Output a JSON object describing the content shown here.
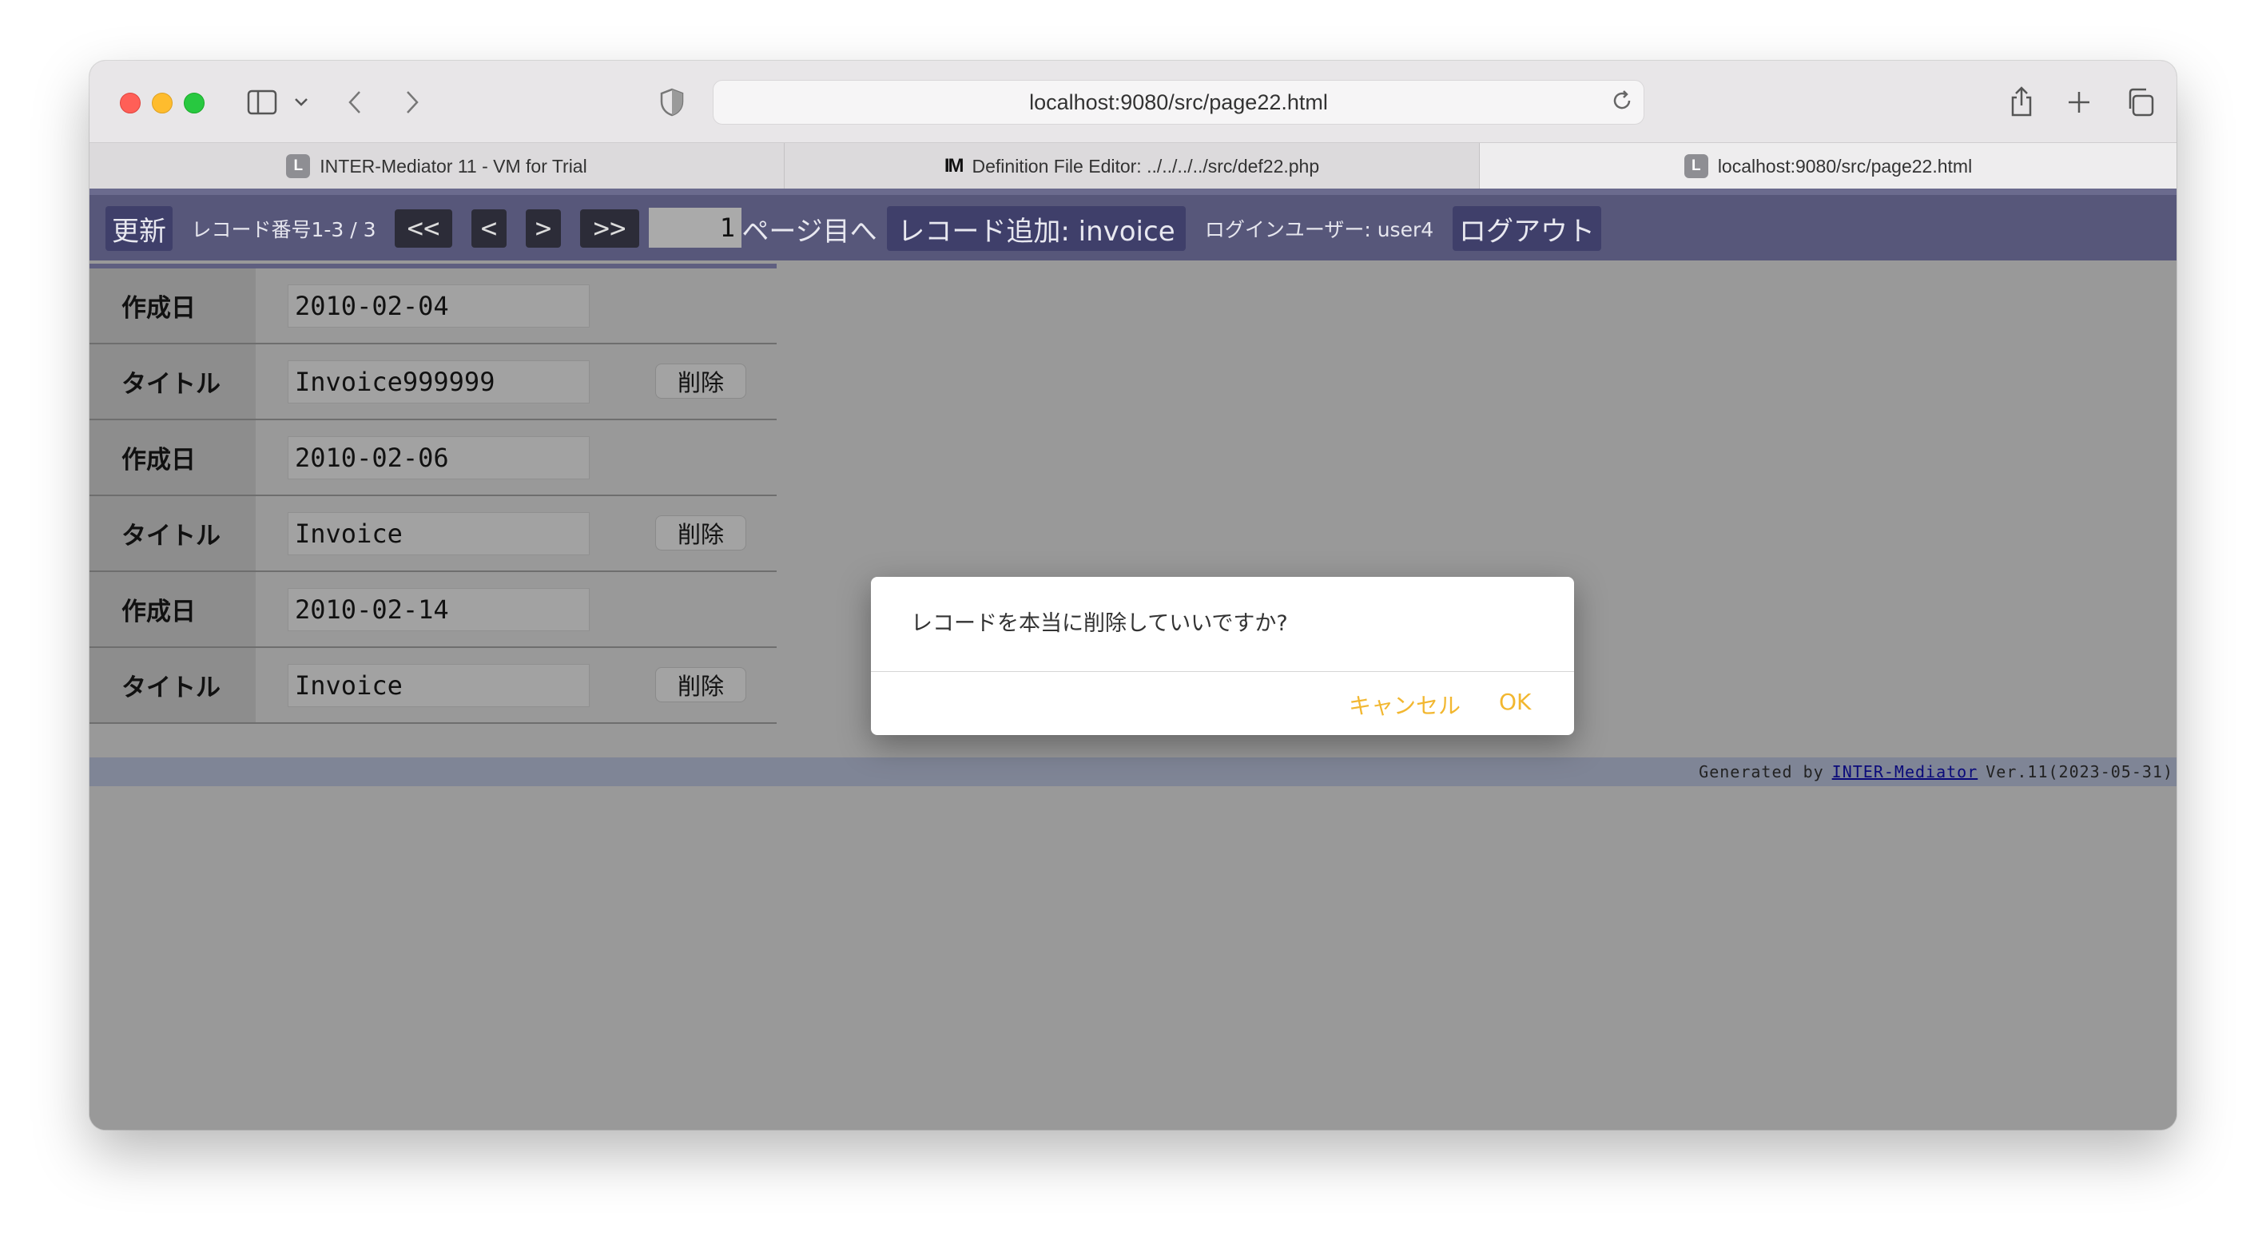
{
  "browser": {
    "url": "localhost:9080/src/page22.html",
    "tabs": [
      {
        "favicon": "L",
        "label": "INTER-Mediator 11 - VM for Trial"
      },
      {
        "favicon": "IM",
        "label": "Definition File Editor: ../../../../src/def22.php"
      },
      {
        "favicon": "L",
        "label": "localhost:9080/src/page22.html"
      }
    ]
  },
  "navbar": {
    "refresh": "更新",
    "record_range": "レコード番号1-3 / 3",
    "first": "<<",
    "prev": "<",
    "next": ">",
    "last": ">>",
    "page_value": "1",
    "page_label": "ページ目へ",
    "add_record": "レコード追加: invoice",
    "login_user": "ログインユーザー: user4",
    "logout": "ログアウト"
  },
  "records": [
    {
      "date_label": "作成日",
      "date": "2010-02-04",
      "title_label": "タイトル",
      "title": "Invoice999999",
      "delete": "削除"
    },
    {
      "date_label": "作成日",
      "date": "2010-02-06",
      "title_label": "タイトル",
      "title": "Invoice",
      "delete": "削除"
    },
    {
      "date_label": "作成日",
      "date": "2010-02-14",
      "title_label": "タイトル",
      "title": "Invoice",
      "delete": "削除"
    }
  ],
  "footer": {
    "prefix": "Generated by",
    "link": "INTER-Mediator",
    "suffix": "Ver.11(2023-05-31)"
  },
  "dialog": {
    "message": "レコードを本当に削除していいですか?",
    "cancel": "キャンセル",
    "ok": "OK"
  },
  "colors": {
    "navbar": "#57577a",
    "nav_button": "#3f3f6a",
    "dialog_accent": "#f2b730",
    "overlay": "#999999"
  }
}
